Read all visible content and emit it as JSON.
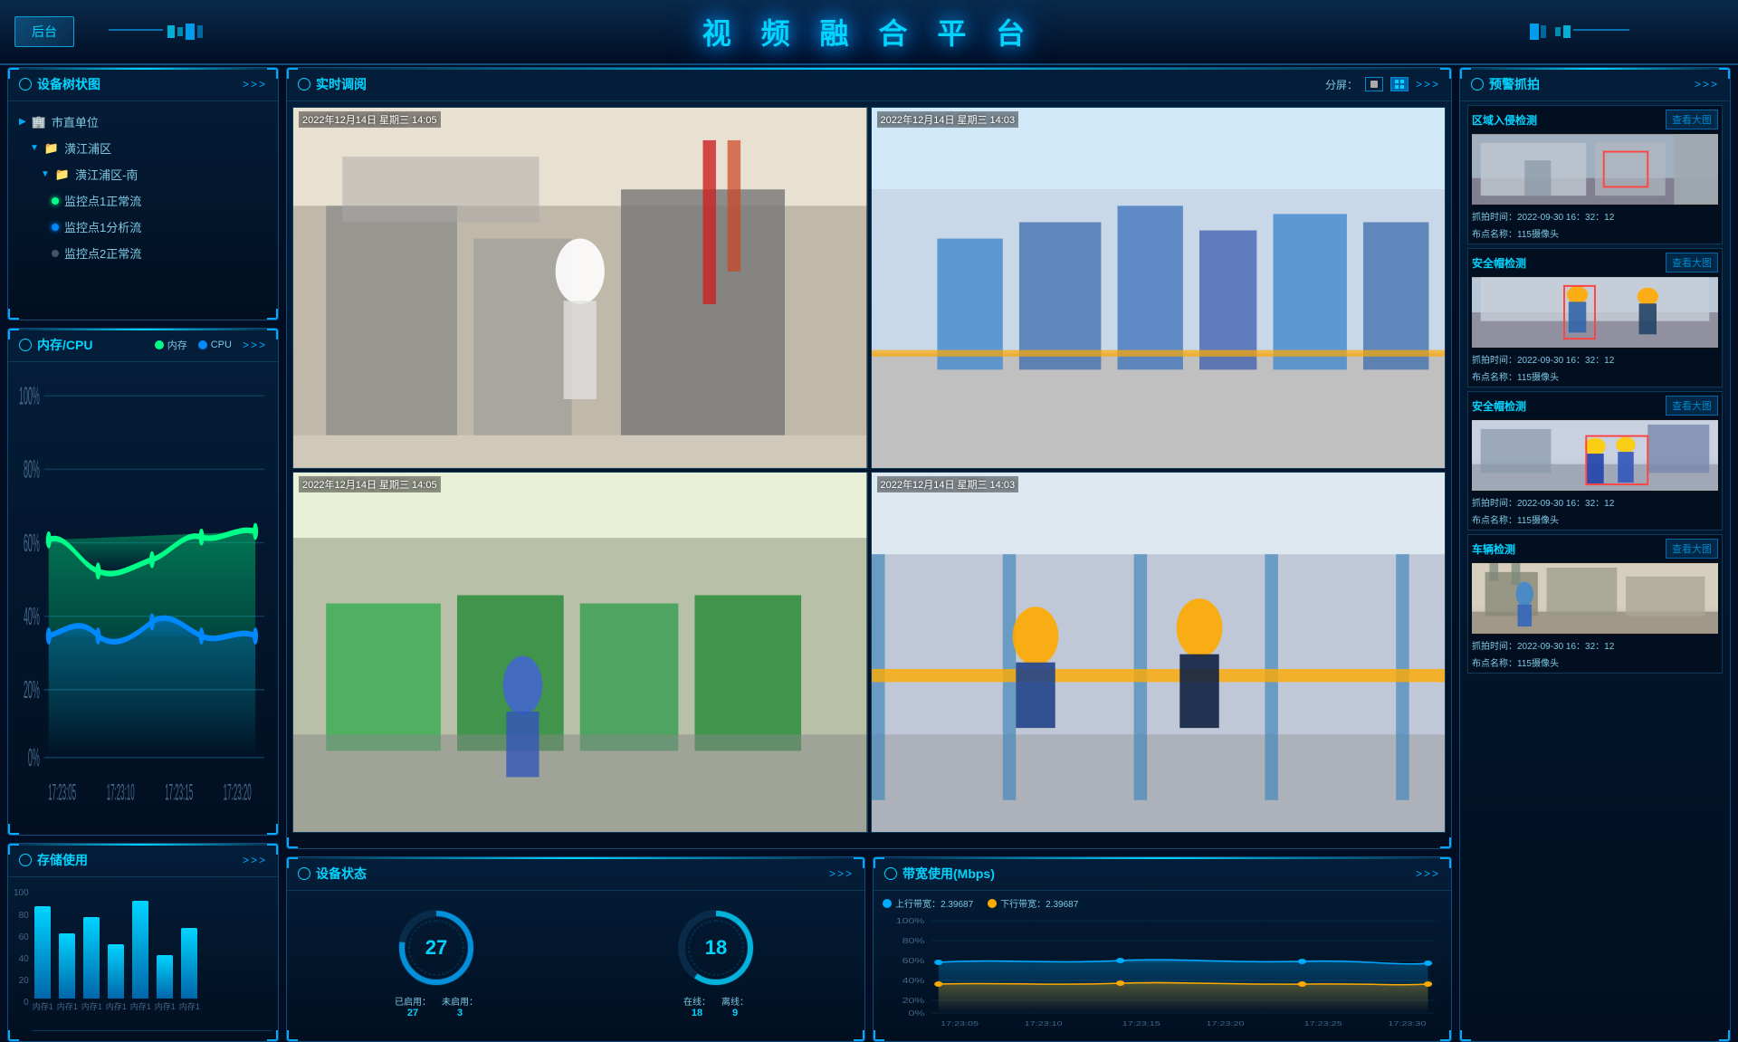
{
  "header": {
    "title": "视 频 融 合 平 台",
    "back_label": "后台",
    "more_label": ">>>"
  },
  "device_tree": {
    "title": "设备树状图",
    "items": [
      {
        "label": "市直单位",
        "level": 0,
        "type": "folder",
        "expanded": false
      },
      {
        "label": "潢江浦区",
        "level": 1,
        "type": "folder",
        "expanded": true
      },
      {
        "label": "潢江浦区-南",
        "level": 2,
        "type": "folder",
        "expanded": true
      },
      {
        "label": "监控点1正常流",
        "level": 3,
        "type": "green"
      },
      {
        "label": "监控点1分析流",
        "level": 3,
        "type": "blue"
      },
      {
        "label": "监控点2正常流",
        "level": 3,
        "type": "gray"
      }
    ]
  },
  "cpu_panel": {
    "title": "内存/CPU",
    "legend_memory": "内存",
    "legend_cpu": "CPU",
    "y_labels": [
      "100%",
      "80%",
      "60%",
      "40%",
      "20%",
      "0%"
    ],
    "x_labels": [
      "17:23:05",
      "17:23:10",
      "17:23:15",
      "17:23:20"
    ],
    "memory_data": [
      65,
      60,
      58,
      55,
      57,
      60,
      62,
      58,
      60,
      65,
      68,
      65
    ],
    "cpu_data": [
      38,
      40,
      42,
      38,
      36,
      40,
      44,
      42,
      38,
      36,
      40,
      38
    ]
  },
  "storage_panel": {
    "title": "存储使用",
    "y_labels": [
      "100",
      "80",
      "60",
      "40",
      "20",
      "0"
    ],
    "bars": [
      {
        "label": "内存1",
        "value": 85
      },
      {
        "label": "内存1",
        "value": 60
      },
      {
        "label": "内存1",
        "value": 75
      },
      {
        "label": "内存1",
        "value": 50
      },
      {
        "label": "内存1",
        "value": 90
      },
      {
        "label": "内存1",
        "value": 40
      },
      {
        "label": "内存1",
        "value": 65
      }
    ]
  },
  "realtime": {
    "title": "实时调阅",
    "split_label": "分屏：",
    "videos": [
      {
        "timestamp": "2022年12月14日 星期三 14:05"
      },
      {
        "timestamp": "2022年12月14日 星期三 14:03"
      },
      {
        "timestamp": "2022年12月14日 星期三 14:05"
      },
      {
        "timestamp": "2022年12月14日 星期三 14:03"
      }
    ]
  },
  "device_status": {
    "title": "设备状态",
    "gauge1_value": "27",
    "gauge1_label1": "已启用：",
    "gauge1_val1": "27",
    "gauge1_label2": "未启用：",
    "gauge1_val2": "3",
    "gauge2_value": "18",
    "gauge2_label1": "在线：",
    "gauge2_val1": "18",
    "gauge2_label2": "离线：",
    "gauge2_val2": "9"
  },
  "bandwidth": {
    "title": "带宽使用(Mbps)",
    "legend_up": "上行带宽：2.39687",
    "legend_down": "下行带宽：2.39687",
    "y_labels": [
      "100%",
      "80%",
      "60%",
      "40%",
      "20%",
      "0%"
    ],
    "x_labels": [
      "17:23:05",
      "17:23:10",
      "17:23:15",
      "17:23:20",
      "17:23:25",
      "17:23:30"
    ]
  },
  "alerts": {
    "title": "预警抓拍",
    "items": [
      {
        "type": "区域入侵检测",
        "view_label": "查看大图",
        "time": "抓拍时间：2022-09-30 16：32：12",
        "location": "布点名称：115摄像头"
      },
      {
        "type": "安全帽检测",
        "view_label": "查看大图",
        "time": "抓拍时间：2022-09-30 16：32：12",
        "location": "布点名称：115摄像头"
      },
      {
        "type": "安全帽检测",
        "view_label": "查看大图",
        "time": "抓拍时间：2022-09-30 16：32：12",
        "location": "布点名称：115摄像头"
      },
      {
        "type": "车辆检测",
        "view_label": "查看大图",
        "time": "抓拍时间：2022-09-30 16：32：12",
        "location": "布点名称：115摄像头"
      }
    ]
  },
  "colors": {
    "primary": "#00d4ff",
    "secondary": "#0088cc",
    "bg_panel": "#041e3a",
    "border": "#0e4d7a",
    "green": "#00ff88",
    "blue": "#0088ff",
    "orange": "#ffaa00"
  }
}
